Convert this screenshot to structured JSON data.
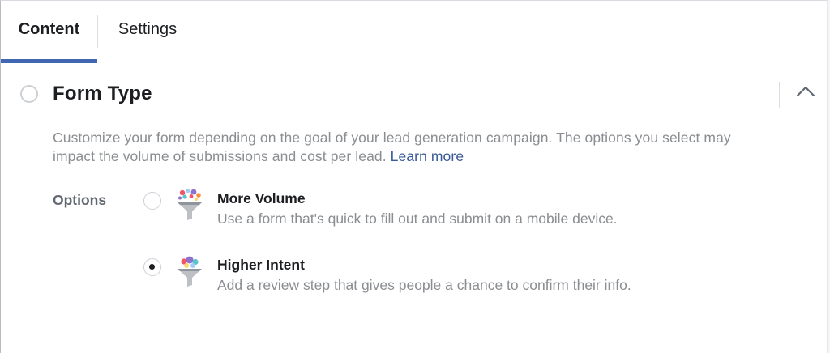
{
  "tabs": {
    "content_label": "Content",
    "settings_label": "Settings"
  },
  "section": {
    "title": "Form Type",
    "collapse_icon": "chevron-up-icon",
    "description_text": "Customize your form depending on the goal of your lead generation campaign. The options you select may impact the volume of submissions and cost per lead. ",
    "learn_more_label": "Learn more"
  },
  "options": {
    "label": "Options",
    "items": [
      {
        "title": "More Volume",
        "description": "Use a form that's quick to fill out and submit on a mobile device.",
        "selected": false,
        "icon": "funnel-icon"
      },
      {
        "title": "Higher Intent",
        "description": "Add a review step that gives people a chance to confirm their info.",
        "selected": true,
        "icon": "funnel-icon"
      }
    ]
  },
  "colors": {
    "accent": "#4267b2",
    "link": "#385898",
    "muted_text": "#8a8d91"
  }
}
